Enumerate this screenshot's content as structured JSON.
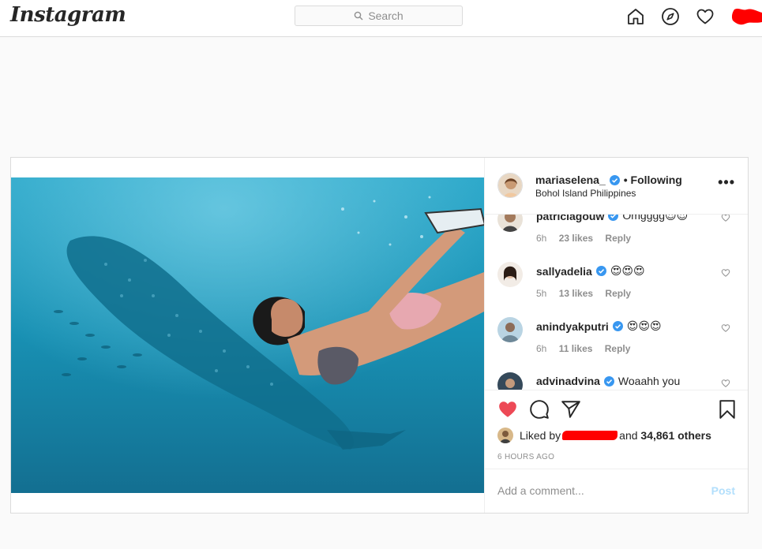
{
  "nav": {
    "logo": "Instagram",
    "search_placeholder": "Search",
    "icons": [
      "home-icon",
      "explore-icon",
      "activity-heart-icon",
      "profile-avatar"
    ]
  },
  "post": {
    "username": "mariaselena_",
    "follow_status": "• Following",
    "location": "Bohol Island Philippines",
    "more": "•••",
    "comments": [
      {
        "user": "patriciagouw",
        "text": "Omgggg😍😍",
        "time": "6h",
        "likes": "23 likes",
        "reply": "Reply"
      },
      {
        "user": "sallyadelia",
        "text": "😍😍😍",
        "time": "5h",
        "likes": "13 likes",
        "reply": "Reply"
      },
      {
        "user": "anindyakputri",
        "text": "😍😍😍",
        "time": "6h",
        "likes": "11 likes",
        "reply": "Reply"
      },
      {
        "user": "advinadvina",
        "text": "Woaahh you",
        "time": "",
        "likes": "",
        "reply": ""
      }
    ],
    "liked_by_prefix": "Liked by",
    "liked_by_and": "and",
    "liked_by_count": "34,861 others",
    "timestamp": "6 HOURS AGO",
    "comment_placeholder": "Add a comment...",
    "post_label": "Post"
  },
  "colors": {
    "like_red": "#ed4956",
    "verified_blue": "#3897f0",
    "redaction": "#ff0000"
  }
}
